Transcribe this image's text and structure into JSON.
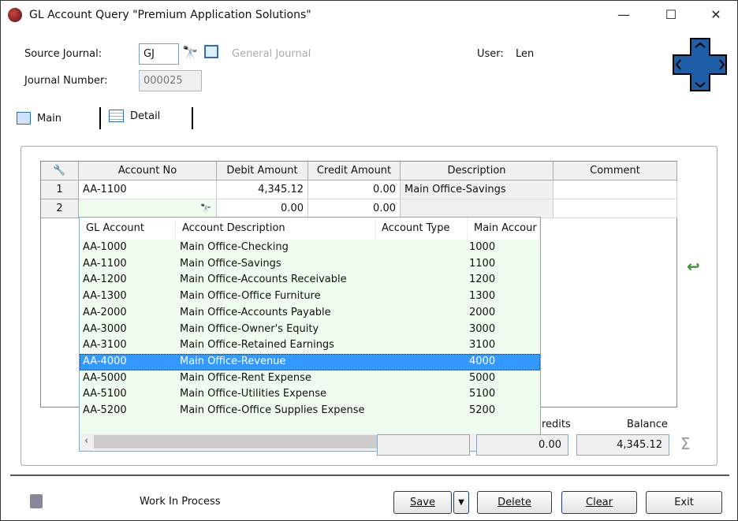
{
  "window": {
    "title": "GL Account Query \"Premium Application Solutions\"",
    "minimize": "—",
    "maximize": "☐",
    "close": "✕"
  },
  "header": {
    "source_journal_label": "Source Journal:",
    "source_journal_value": "GJ",
    "source_journal_desc": "General Journal",
    "journal_number_label": "Journal Number:",
    "journal_number_value": "000025",
    "user_label": "User:",
    "user_value": "Len"
  },
  "tabs": [
    {
      "label": "Main"
    },
    {
      "label": "Detail"
    }
  ],
  "grid": {
    "columns": [
      "Account No",
      "Debit Amount",
      "Credit Amount",
      "Description",
      "Comment"
    ],
    "rows": [
      {
        "num": "1",
        "account": "AA-1100",
        "debit": "4,345.12",
        "credit": "0.00",
        "description": "Main Office-Savings",
        "comment": ""
      },
      {
        "num": "2",
        "account": "",
        "debit": "0.00",
        "credit": "0.00",
        "description": "",
        "comment": ""
      }
    ]
  },
  "lookup": {
    "columns": [
      "GL Account",
      "Account Description",
      "Account Type",
      "Main Accour"
    ],
    "rows": [
      {
        "account": "AA-1000",
        "description": "Main Office-Checking",
        "type": "",
        "main": "1000"
      },
      {
        "account": "AA-1100",
        "description": "Main Office-Savings",
        "type": "",
        "main": "1100"
      },
      {
        "account": "AA-1200",
        "description": "Main Office-Accounts Receivable",
        "type": "",
        "main": "1200"
      },
      {
        "account": "AA-1300",
        "description": "Main Office-Office Furniture",
        "type": "",
        "main": "1300"
      },
      {
        "account": "AA-2000",
        "description": "Main Office-Accounts Payable",
        "type": "",
        "main": "2000"
      },
      {
        "account": "AA-3000",
        "description": "Main Office-Owner's Equity",
        "type": "",
        "main": "3000"
      },
      {
        "account": "AA-3100",
        "description": "Main Office-Retained Earnings",
        "type": "",
        "main": "3100"
      },
      {
        "account": "AA-4000",
        "description": "Main Office-Revenue",
        "type": "",
        "main": "4000"
      },
      {
        "account": "AA-5000",
        "description": "Main Office-Rent Expense",
        "type": "",
        "main": "5000"
      },
      {
        "account": "AA-5100",
        "description": "Main Office-Utilities Expense",
        "type": "",
        "main": "5100"
      },
      {
        "account": "AA-5200",
        "description": "Main Office-Office Supplies Expense",
        "type": "",
        "main": "5200"
      }
    ],
    "selected_index": 7
  },
  "totals": {
    "credits_label": "redits",
    "credits_value": "0.00",
    "balance_label": "Balance",
    "balance_value": "4,345.12"
  },
  "footer": {
    "status": "Work In Process",
    "save": "Save",
    "delete": "Delete",
    "clear": "Clear",
    "exit": "Exit"
  },
  "colors": {
    "selection": "#3399ff",
    "lookup_bg": "#effdef",
    "nav_blue": "#1f5fa8"
  }
}
